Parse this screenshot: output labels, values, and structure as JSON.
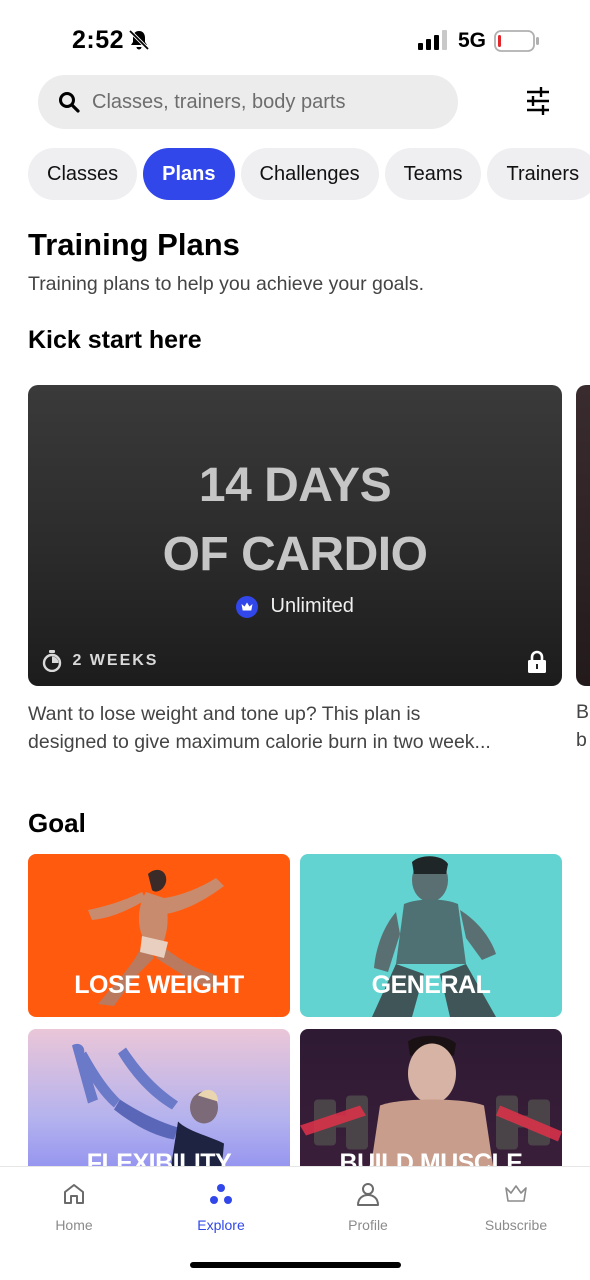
{
  "status_bar": {
    "time": "2:52",
    "network": "5G"
  },
  "search": {
    "placeholder": "Classes, trainers, body parts"
  },
  "tabs": [
    {
      "label": "Classes",
      "active": false
    },
    {
      "label": "Plans",
      "active": true
    },
    {
      "label": "Challenges",
      "active": false
    },
    {
      "label": "Teams",
      "active": false
    },
    {
      "label": "Trainers",
      "active": false
    }
  ],
  "page": {
    "title": "Training Plans",
    "subtitle": "Training plans to help you achieve your goals."
  },
  "kick_start": {
    "heading": "Kick start here",
    "card": {
      "title_line1": "14 DAYS",
      "title_line2": "OF CARDIO",
      "badge": "Unlimited",
      "duration": "2 WEEKS",
      "description_line1": "Want to lose weight and tone up? This plan is",
      "description_line2": "designed to give maximum calorie burn in two week..."
    },
    "next_card_peek": {
      "line1": "B",
      "line2": "b"
    }
  },
  "goal": {
    "heading": "Goal",
    "tiles": [
      {
        "label": "LOSE WEIGHT",
        "color": "#ff5a0e"
      },
      {
        "label": "GENERAL",
        "color": "#62d3d0"
      },
      {
        "label": "FLEXIBILITY",
        "color": "#b4b2ee"
      },
      {
        "label": "BUILD MUSCLE",
        "color": "#3b1f3a"
      }
    ]
  },
  "bottom_nav": [
    {
      "label": "Home",
      "icon": "home-icon",
      "active": false
    },
    {
      "label": "Explore",
      "icon": "explore-icon",
      "active": true
    },
    {
      "label": "Profile",
      "icon": "profile-icon",
      "active": false
    },
    {
      "label": "Subscribe",
      "icon": "crown-icon",
      "active": false
    }
  ],
  "colors": {
    "accent": "#3147ea",
    "tab_bg": "#efeff2",
    "search_bg": "#ececec"
  }
}
